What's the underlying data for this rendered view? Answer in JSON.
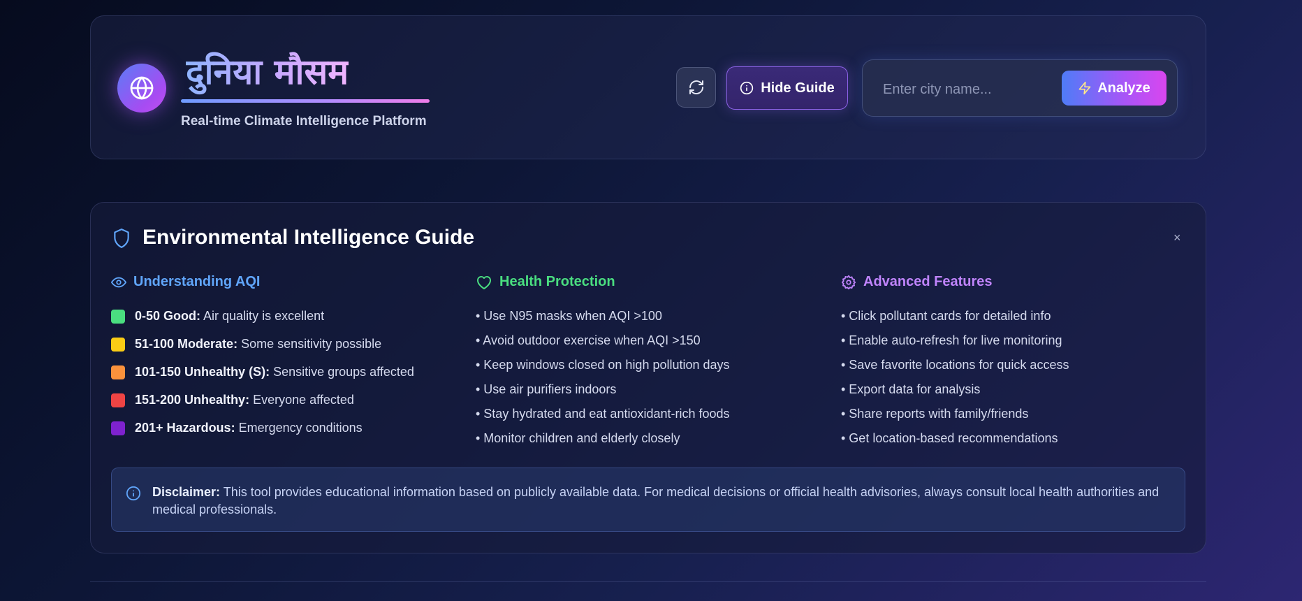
{
  "header": {
    "title": "दुनिया मौसम",
    "subtitle": "Real-time Climate Intelligence Platform",
    "logo_icon": "globe-icon",
    "refresh_icon": "refresh-icon",
    "guide_button": "Hide Guide",
    "search_placeholder": "Enter city name...",
    "analyze_button": "Analyze"
  },
  "guide": {
    "title": "Environmental Intelligence Guide",
    "close": "×",
    "columns": [
      {
        "heading": "Understanding AQI",
        "icon": "eye-icon",
        "color": "#60a5fa",
        "items": [
          {
            "range": "0-50 Good:",
            "desc": "Air quality is excellent",
            "color": "#4ade80"
          },
          {
            "range": "51-100 Moderate:",
            "desc": "Some sensitivity possible",
            "color": "#facc15"
          },
          {
            "range": "101-150 Unhealthy (S):",
            "desc": "Sensitive groups affected",
            "color": "#fb923c"
          },
          {
            "range": "151-200 Unhealthy:",
            "desc": "Everyone affected",
            "color": "#ef4444"
          },
          {
            "range": "201+ Hazardous:",
            "desc": "Emergency conditions",
            "color": "#7e22ce"
          }
        ]
      },
      {
        "heading": "Health Protection",
        "icon": "heart-icon",
        "color": "#4ade80",
        "items": [
          "• Use N95 masks when AQI >100",
          "• Avoid outdoor exercise when AQI >150",
          "• Keep windows closed on high pollution days",
          "• Use air purifiers indoors",
          "• Stay hydrated and eat antioxidant-rich foods",
          "• Monitor children and elderly closely"
        ]
      },
      {
        "heading": "Advanced Features",
        "icon": "gear-icon",
        "color": "#c084fc",
        "items": [
          "• Click pollutant cards for detailed info",
          "• Enable auto-refresh for live monitoring",
          "• Save favorite locations for quick access",
          "• Export data for analysis",
          "• Share reports with family/friends",
          "• Get location-based recommendations"
        ]
      }
    ],
    "disclaimer": {
      "label": "Disclaimer:",
      "text": " This tool provides educational information based on publicly available data. For medical decisions or official health advisories, always consult local health authorities and medical professionals."
    }
  }
}
